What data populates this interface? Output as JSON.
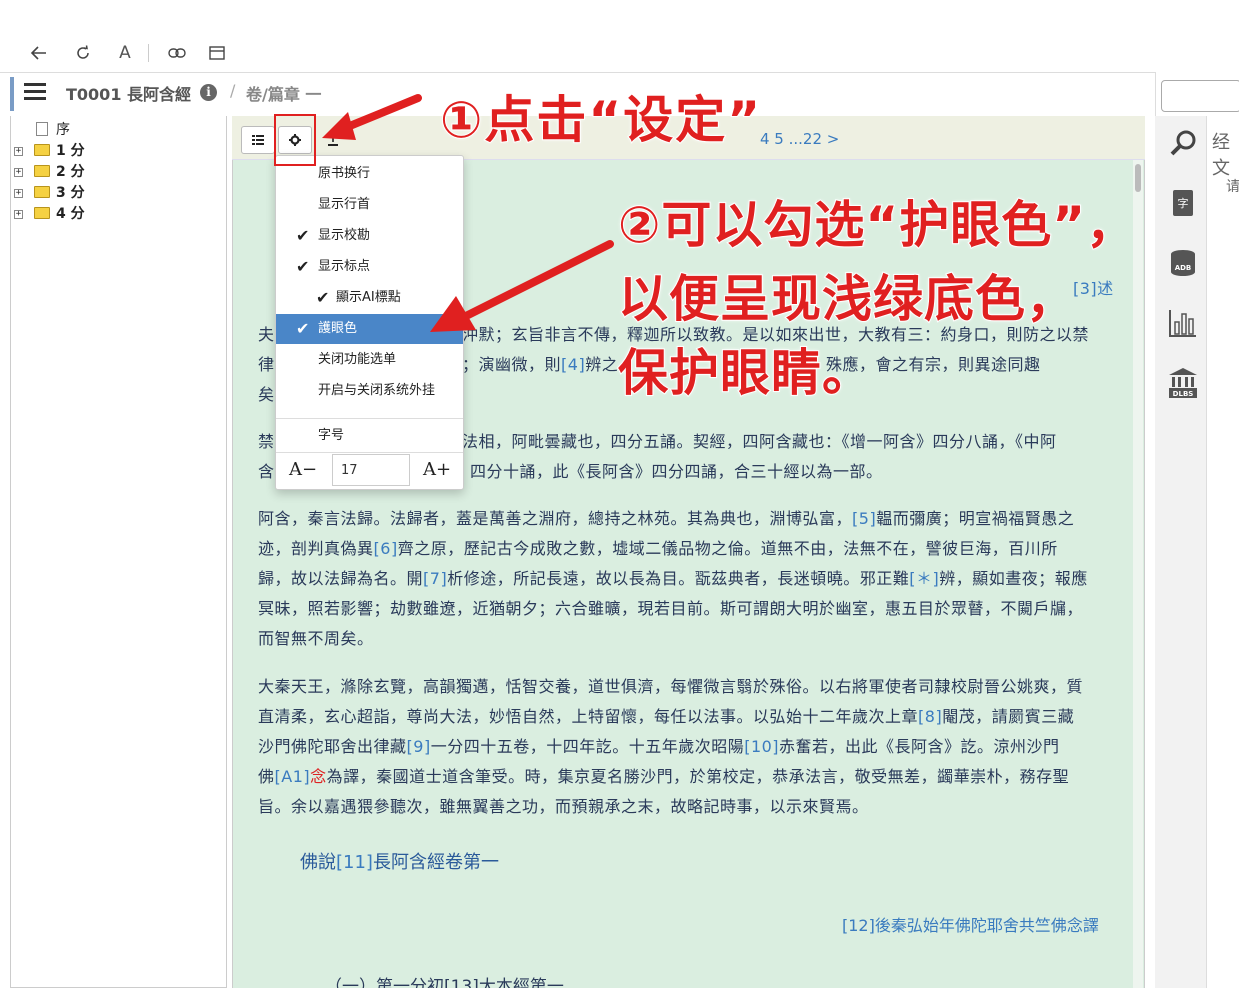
{
  "toolbar": {
    "back_icon": "arrow-left-icon",
    "reload_icon": "reload-icon",
    "font_label": "A",
    "link_icon": "link-icon",
    "window_icon": "window-icon"
  },
  "header": {
    "title": "T0001 長阿含經",
    "separator": "/",
    "chapter": "卷/篇章 一"
  },
  "tree": {
    "items": [
      {
        "label": "序",
        "type": "page"
      },
      {
        "label": "1 分",
        "type": "folder"
      },
      {
        "label": "2 分",
        "type": "folder"
      },
      {
        "label": "3 分",
        "type": "folder"
      },
      {
        "label": "4 分",
        "type": "folder"
      }
    ]
  },
  "content_toolbar": {
    "list_button": "≡",
    "settings_button": "⚙",
    "export_button": "⇪",
    "pager": "4 5 ...22 >"
  },
  "menu": {
    "items": [
      {
        "label": "原书换行",
        "checked": false
      },
      {
        "label": "显示行首",
        "checked": false
      },
      {
        "label": "显示校勘",
        "checked": true
      },
      {
        "label": "显示标点",
        "checked": true
      },
      {
        "label": "顯示AI標點",
        "checked": true
      },
      {
        "label": "護眼色",
        "checked": true,
        "active": true
      },
      {
        "label": "关闭功能选单",
        "checked": false
      },
      {
        "label": "开启与关闭系统外挂",
        "checked": false
      }
    ],
    "font_size_label": "字号",
    "font_decrease": "A−",
    "font_size_value": "17",
    "font_increase": "A+"
  },
  "content": {
    "p0_tail": "[3]述",
    "p1_l1": "夫",
    "p1_l1b": "沖默；玄旨非言不傳，釋迦所以致教。是以如來出世，大教有三：約身口，則防之以禁",
    "p1_l2": "律",
    "p1_l2b": "；演幽微，則",
    "p1_l2c": "[4]",
    "p1_l2d": "辨之",
    "p1_l2e": "殊應，會之有宗，則異途同趣",
    "p1_l3": "矣",
    "p2_l1": "禁",
    "p2_l1b": "法相，阿毗曇藏也，四分五誦。契經，四阿含藏也：《增一阿含》四分八誦，《中阿",
    "p2_l2": "含",
    "p2_l2b": "四分十誦，此《長阿含》四分四誦，合三十經以為一部。",
    "p3_l1a": "阿含，秦言法歸。法歸者，蓋是萬善之淵府，總持之林苑。其為典也，淵博弘富，",
    "p3_l1r": "[5]",
    "p3_l1b": "韞而彌廣；明宣禍福賢愚之",
    "p3_l2a": "迹，剖判真偽異",
    "p3_l2r": "[6]",
    "p3_l2b": "齊之原，歷記古今成敗之數，墟域二儀品物之倫。道無不由，法無不在，譬彼巨海，百川所",
    "p3_l3a": "歸，故以法歸為名。開",
    "p3_l3r": "[7]",
    "p3_l3b": "析修途，所記長遠，故以長為目。翫茲典者，長迷頓曉。邪正難",
    "p3_l3r2": "[＊]",
    "p3_l3c": "辨，顯如晝夜；報應",
    "p3_l4": "冥昧，照若影響；劫數雖遼，近猶朝夕；六合雖曠，現若目前。斯可謂朗大明於幽室，惠五目於眾瞽，不闚戶牖，",
    "p3_l5": "而智無不周矣。",
    "p4_l1": "大秦天王，滌除玄覽，高韻獨邁，恬智交養，道世俱濟，每懼微言翳於殊俗。以右將軍使者司隸校尉晉公姚爽，質",
    "p4_l2a": "直清柔，玄心超詣，尊尚大法，妙悟自然，上特留懷，每任以法事。以弘始十二年歲次上章",
    "p4_l2r": "[8]",
    "p4_l2b": "閹茂，請罽賓三藏",
    "p4_l3a": "沙門佛陀耶舍出律藏",
    "p4_l3r": "[9]",
    "p4_l3b": "一分四十五卷，十四年訖。十五年歲次昭陽",
    "p4_l3r2": "[10]",
    "p4_l3c": "赤奮若，出此《長阿含》訖。涼州沙門",
    "p4_l4a": "佛",
    "p4_l4r": "[A1]",
    "p4_l4red": "念",
    "p4_l4b": "為譯，秦國道士道含筆受。時，集京夏名勝沙門，於第校定，恭承法言，敬受無差，蠲華崇朴，務存聖",
    "p4_l5": "旨。余以嘉遇猥參聽次，雖無翼善之功，而預親承之末，故略記時事，以示來賢焉。",
    "heading_a": "佛說",
    "heading_r": "[11]",
    "heading_b": "長阿含經卷第一",
    "translator": "[12]後秦弘始年佛陀耶舍共竺佛念譯",
    "section": "（一）第一分初[13]大本經第一"
  },
  "right_panel": {
    "tab_label": "经文",
    "hint_char": "请",
    "icons": [
      "search-icon",
      "dictionary-icon",
      "database-icon",
      "statistics-icon",
      "library-icon"
    ]
  },
  "callouts": {
    "step1": "①点击“设定”",
    "step2_l1": "②可以勾选“护眼色”，",
    "step2_l2": "以便呈现浅绿底色，",
    "step2_l3": "保护眼睛。"
  },
  "colors": {
    "content_bg": "#daeee0",
    "accent": "#4a86c8",
    "annotation": "#e02020",
    "link": "#3a7bbf"
  }
}
